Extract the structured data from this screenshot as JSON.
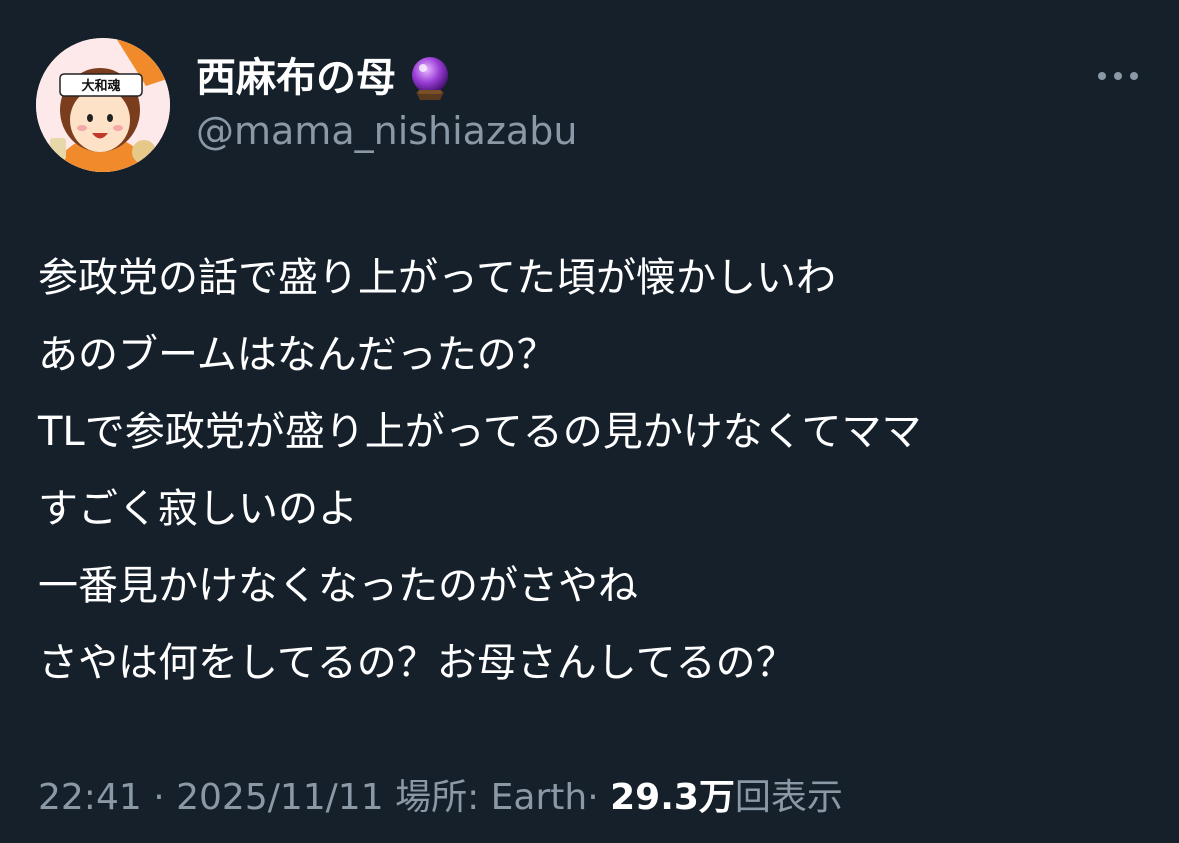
{
  "author": {
    "display_name": "西麻布の母",
    "badge_icon": "crystal-ball-icon",
    "handle": "@mama_nishiazabu",
    "avatar_headband_text": "大和魂"
  },
  "more_icon": "more-horizontal-icon",
  "tweet": {
    "lines": [
      "参政党の話で盛り上がってた頃が懐かしいわ",
      "あのブームはなんだったの？",
      "TLで参政党が盛り上がってるの見かけなくてママ",
      "すごく寂しいのよ",
      "一番見かけなくなったのがさやね",
      "さやは何をしてるの？お母さんしてるの？"
    ]
  },
  "meta": {
    "time": "22:41",
    "separator": "·",
    "date": "2025/11/11",
    "location": "場所: Earth",
    "views_count": "29.3万",
    "views_label": "回表示"
  },
  "colors": {
    "background": "#15202b",
    "primary_text": "#ffffff",
    "secondary_text": "#8b98a5",
    "avatar_accent": "#f08a2a"
  }
}
